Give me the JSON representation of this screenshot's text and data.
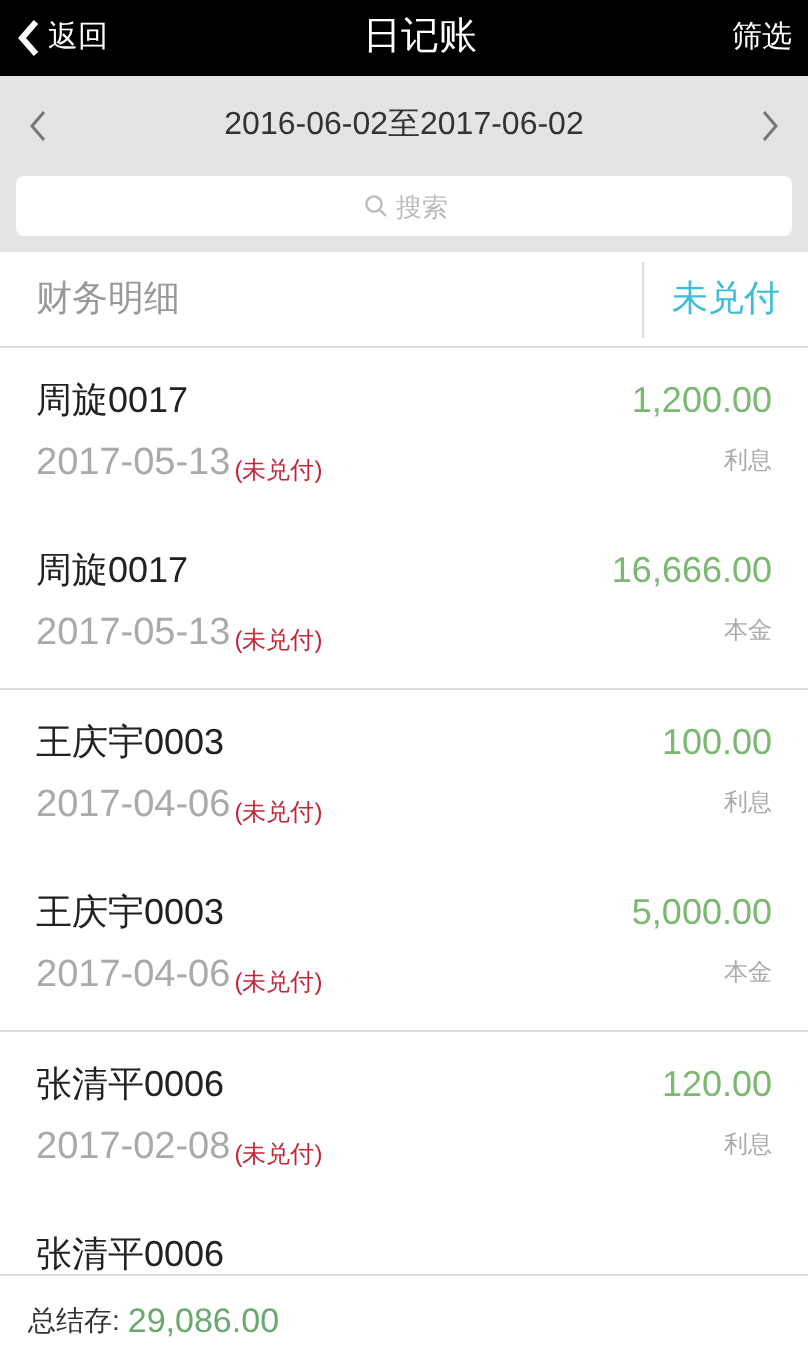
{
  "header": {
    "back": "返回",
    "title": "日记账",
    "filter": "筛选"
  },
  "date_range": "2016-06-02至2017-06-02",
  "search": {
    "placeholder": "搜索"
  },
  "section": {
    "title": "财务明细",
    "status_filter": "未兑付"
  },
  "groups": [
    {
      "entries": [
        {
          "name": "周旋0017",
          "date": "2017-05-13",
          "status": "(未兑付)",
          "amount": "1,200.00",
          "type": "利息"
        },
        {
          "name": "周旋0017",
          "date": "2017-05-13",
          "status": "(未兑付)",
          "amount": "16,666.00",
          "type": "本金"
        }
      ]
    },
    {
      "entries": [
        {
          "name": "王庆宇0003",
          "date": "2017-04-06",
          "status": "(未兑付)",
          "amount": "100.00",
          "type": "利息"
        },
        {
          "name": "王庆宇0003",
          "date": "2017-04-06",
          "status": "(未兑付)",
          "amount": "5,000.00",
          "type": "本金"
        }
      ]
    },
    {
      "entries": [
        {
          "name": "张清平0006",
          "date": "2017-02-08",
          "status": "(未兑付)",
          "amount": "120.00",
          "type": "利息"
        },
        {
          "name": "张清平0006"
        }
      ]
    }
  ],
  "footer": {
    "label": "总结存:",
    "total": "29,086.00"
  }
}
